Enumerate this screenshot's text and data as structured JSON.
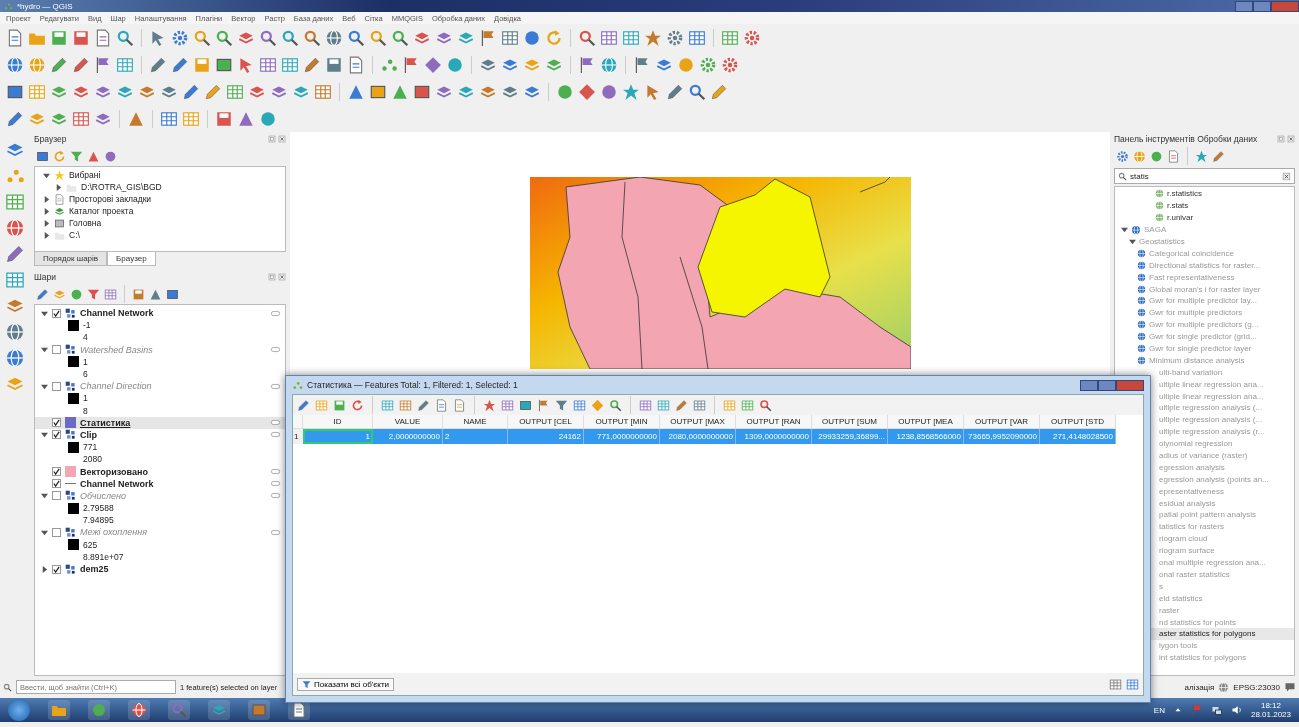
{
  "window": {
    "title": "*hydro — QGIS"
  },
  "menu": [
    "Проект",
    "Редагувати",
    "Вид",
    "Шар",
    "Налаштування",
    "Плагіни",
    "Вектор",
    "Растр",
    "База даних",
    "Веб",
    "Сітка",
    "MMQGIS",
    "Обробка даних",
    "Довідка"
  ],
  "browser": {
    "title": "Браузер",
    "items": [
      {
        "label": "Вибрані",
        "kind": "favorites",
        "expanded": true,
        "children": [
          {
            "label": "D:\\ROTRA_GIS\\BGD",
            "kind": "folder",
            "expanded": false
          }
        ]
      },
      {
        "label": "Просторові закладки",
        "kind": "bookmarks",
        "expanded": false
      },
      {
        "label": "Каталог проекта",
        "kind": "project",
        "expanded": false
      },
      {
        "label": "Головна",
        "kind": "home",
        "expanded": false
      },
      {
        "label": "C:\\",
        "kind": "folder",
        "expanded": false
      }
    ]
  },
  "dock_tabs": [
    {
      "label": "Порядок шарів",
      "selected": false
    },
    {
      "label": "Браузер",
      "selected": true
    }
  ],
  "layers": {
    "title": "Шари",
    "items": [
      {
        "name": "Channel Network",
        "kind": "raster",
        "checked": true,
        "expanded": true,
        "selected": false,
        "indicator": true,
        "legend": [
          "-1",
          "4"
        ]
      },
      {
        "name": "Watershed Basins",
        "kind": "raster",
        "checked": false,
        "expanded": true,
        "selected": false,
        "indicator": true,
        "legend": [
          "1",
          "6"
        ]
      },
      {
        "name": "Channel Direction",
        "kind": "raster",
        "checked": false,
        "expanded": true,
        "selected": false,
        "indicator": true,
        "legend": [
          "1",
          "8"
        ]
      },
      {
        "name": "Статистика",
        "kind": "polygon",
        "color": "#6b6bc4",
        "checked": true,
        "selected": true,
        "indicator": true
      },
      {
        "name": "Clip",
        "kind": "raster",
        "checked": true,
        "expanded": true,
        "selected": false,
        "indicator": true,
        "legend": [
          "771",
          "2080"
        ]
      },
      {
        "name": "Векторизовано",
        "kind": "polygon",
        "color": "#f2a7b2",
        "checked": true,
        "selected": false,
        "indicator": true
      },
      {
        "name": "Channel Network",
        "kind": "line",
        "checked": true,
        "selected": false,
        "indicator": true
      },
      {
        "name": "Обчислено",
        "kind": "raster",
        "checked": false,
        "expanded": true,
        "selected": false,
        "indicator": true,
        "legend": [
          "2.79588",
          "7.94895"
        ]
      },
      {
        "name": "Межі охоплення",
        "kind": "raster",
        "checked": false,
        "expanded": true,
        "selected": false,
        "indicator": true,
        "legend": [
          "625",
          "8.891e+07"
        ]
      },
      {
        "name": "dem25",
        "kind": "raster",
        "checked": true,
        "expanded": false,
        "selected": false,
        "indicator": false
      }
    ]
  },
  "processing": {
    "title": "Панель інструментів Обробки даних",
    "search": "statis",
    "tree": [
      {
        "label": "r.statistics",
        "kind": "grass",
        "selected": false
      },
      {
        "label": "r.stats",
        "kind": "grass",
        "selected": false
      },
      {
        "label": "r.univar",
        "kind": "grass",
        "selected": false
      },
      {
        "label": "SAGA",
        "kind": "provider",
        "expanded": true,
        "children": [
          {
            "label": "Geostatistics",
            "kind": "group",
            "expanded": true,
            "children": [
              {
                "label": "Categorical coincidence",
                "kind": "saga",
                "selected": false
              },
              {
                "label": "Directional statistics for raster...",
                "kind": "saga",
                "selected": false
              },
              {
                "label": "Fast representativeness",
                "kind": "saga",
                "selected": false
              },
              {
                "label": "Global moran's i for raster layer",
                "kind": "saga",
                "selected": false
              },
              {
                "label": "Gwr for multiple predictor lay...",
                "kind": "saga",
                "selected": false
              },
              {
                "label": "Gwr for multiple predictors",
                "kind": "saga",
                "selected": false
              },
              {
                "label": "Gwr for multiple predictors (g...",
                "kind": "saga",
                "selected": false
              },
              {
                "label": "Gwr for single predictor (grid...",
                "kind": "saga",
                "selected": false
              },
              {
                "label": "Gwr for single predictor layer",
                "kind": "saga",
                "selected": false
              },
              {
                "label": "Minimum distance analysis",
                "kind": "saga",
                "selected": false
              },
              {
                "label": "ulti-band variation",
                "kind": "partial",
                "selected": false
              },
              {
                "label": "ultiple linear regression ana...",
                "kind": "partial",
                "selected": false
              },
              {
                "label": "ultiple linear regression ana...",
                "kind": "partial",
                "selected": false
              },
              {
                "label": "ultiple regression analysis (...",
                "kind": "partial",
                "selected": false
              },
              {
                "label": "ultiple regression analysis (...",
                "kind": "partial",
                "selected": false
              },
              {
                "label": "ultiple regression analysis (r...",
                "kind": "partial",
                "selected": false
              },
              {
                "label": "olynomial regression",
                "kind": "partial",
                "selected": false
              },
              {
                "label": "adius of variance (raster)",
                "kind": "partial",
                "selected": false
              },
              {
                "label": "egression analysis",
                "kind": "partial",
                "selected": false
              },
              {
                "label": "egression analysis (points an...",
                "kind": "partial",
                "selected": false
              },
              {
                "label": "epresentativeness",
                "kind": "partial",
                "selected": false
              },
              {
                "label": "esidual analysis",
                "kind": "partial",
                "selected": false
              },
              {
                "label": "patial point pattern analysis",
                "kind": "partial",
                "selected": false
              },
              {
                "label": "tatistics for rasters",
                "kind": "partial",
                "selected": false
              },
              {
                "label": "riogram cloud",
                "kind": "partial",
                "selected": false
              },
              {
                "label": "riogram surface",
                "kind": "partial",
                "selected": false
              },
              {
                "label": "onal multiple regression ana...",
                "kind": "partial",
                "selected": false
              },
              {
                "label": "onal raster statistics",
                "kind": "partial",
                "selected": false
              },
              {
                "label": "s",
                "kind": "partial",
                "selected": false
              },
              {
                "label": "eld statistics",
                "kind": "partial",
                "selected": false
              },
              {
                "label": "raster",
                "kind": "partial",
                "selected": false
              },
              {
                "label": "nd statistics for points",
                "kind": "partial",
                "selected": false
              },
              {
                "label": "aster statistics for polygons",
                "kind": "partial",
                "selected": true
              },
              {
                "label": "lygon tools",
                "kind": "partial",
                "selected": false
              },
              {
                "label": "int statistics for polygons",
                "kind": "partial",
                "selected": false
              }
            ]
          }
        ]
      }
    ]
  },
  "attribute_table": {
    "title": "Статистика — Features Total: 1, Filtered: 1, Selected: 1",
    "columns": [
      {
        "label": "ID",
        "kind": "number"
      },
      {
        "label": "VALUE",
        "kind": "number"
      },
      {
        "label": "NAME",
        "kind": "text"
      },
      {
        "label": "OUTPUT [CEL",
        "kind": "number"
      },
      {
        "label": "OUTPUT [MIN",
        "kind": "number"
      },
      {
        "label": "OUTPUT [MAX",
        "kind": "number"
      },
      {
        "label": "OUTPUT [RAN",
        "kind": "number"
      },
      {
        "label": "OUTPUT [SUM",
        "kind": "number"
      },
      {
        "label": "OUTPUT [MEA",
        "kind": "number"
      },
      {
        "label": "OUTPUT [VAR",
        "kind": "number"
      },
      {
        "label": "OUTPUT [STD",
        "kind": "number"
      }
    ],
    "rows": [
      {
        "header": "1",
        "selected": true,
        "cells": [
          "1",
          "2,0000000000",
          "2",
          "24162",
          "771,0000000000",
          "2080,0000000000",
          "1309,0000000000",
          "29933259,36899...",
          "1238,8568566000",
          "73665,9952090000",
          "271,4148028500"
        ]
      }
    ],
    "filter_button": "Показати всі об'єкти"
  },
  "status_bar": {
    "search_placeholder": "Ввести, щоб знайти (Ctrl+K)",
    "message": "1 feature(s) selected on layer",
    "render": "алізація",
    "crs": "EPSG:23030"
  },
  "taskbar": {
    "language": "EN",
    "time": "18:12",
    "date": "28.01.2023"
  }
}
